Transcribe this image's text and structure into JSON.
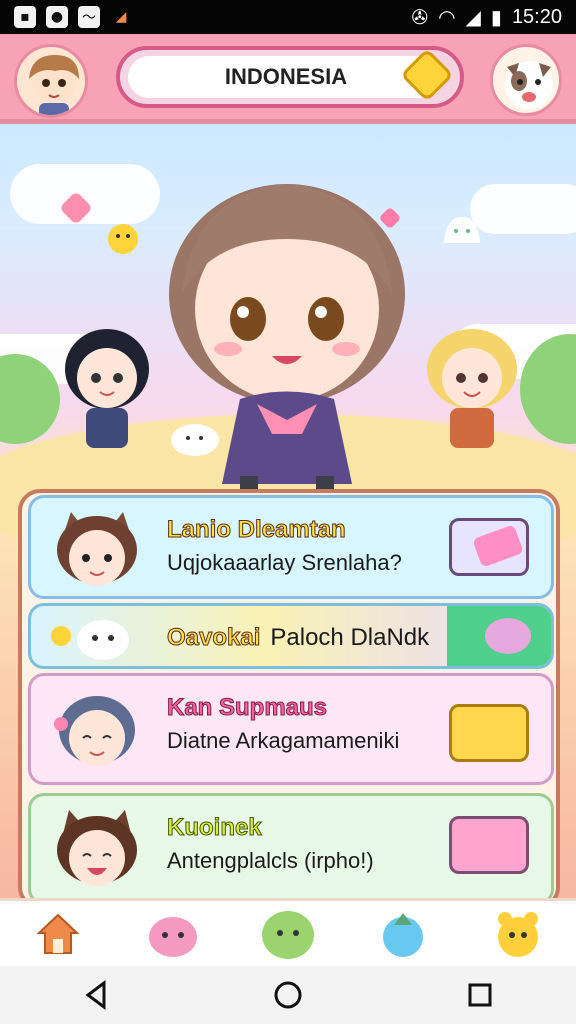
{
  "status_bar": {
    "time": "15:20",
    "left_icons": [
      "gallery-icon",
      "camera-icon",
      "photo-icon",
      "shape-icon"
    ],
    "right_icons": [
      "nfc-icon",
      "wifi-icon",
      "signal-icon",
      "battery-icon"
    ]
  },
  "header": {
    "search_value": "INDONESIA",
    "left_avatar": "profile-avatar",
    "right_avatar": "pet-avatar",
    "gem_icon": "gem-icon"
  },
  "cards": [
    {
      "title": "Lanio Dleamtan",
      "subtitle": "Uqjokaaarlay Srenlaha?",
      "theme_color": "#d8f6ff",
      "border_color": "#86bde6",
      "avatar_icon": "cat-girl-avatar",
      "thumb_icon": "pink-item-icon"
    },
    {
      "title": "Oavokai",
      "subtitle": "Paloch DlaNdk",
      "theme_color": "#d9f3ff",
      "border_color": "#7bbfdb",
      "avatar_icon": "white-cat-avatar",
      "thumb_icon": "green-slime-icon"
    },
    {
      "title": "Kan Supmaus",
      "subtitle": "Diatne Arkagamameniki",
      "theme_color": "#fde6f5",
      "border_color": "#d49ac8",
      "avatar_icon": "blue-hair-avatar",
      "thumb_icon": "yellow-food-icon"
    },
    {
      "title": "Kuoinek",
      "subtitle": "Antengplalcls (irpho!)",
      "theme_color": "#e8f8e6",
      "border_color": "#9ccc91",
      "avatar_icon": "fox-girl-avatar",
      "thumb_icon": "pink-box-icon"
    }
  ],
  "bottom_nav": [
    {
      "icon": "home-icon",
      "color": "#f08a4b"
    },
    {
      "icon": "pink-pet-icon",
      "color": "#f49ac1"
    },
    {
      "icon": "green-pet-icon",
      "color": "#9bd36f"
    },
    {
      "icon": "blue-drop-icon",
      "color": "#69c8f0"
    },
    {
      "icon": "yellow-bear-icon",
      "color": "#ffcf3c"
    }
  ],
  "system_nav": [
    "back-icon",
    "home-circle-icon",
    "recents-icon"
  ]
}
